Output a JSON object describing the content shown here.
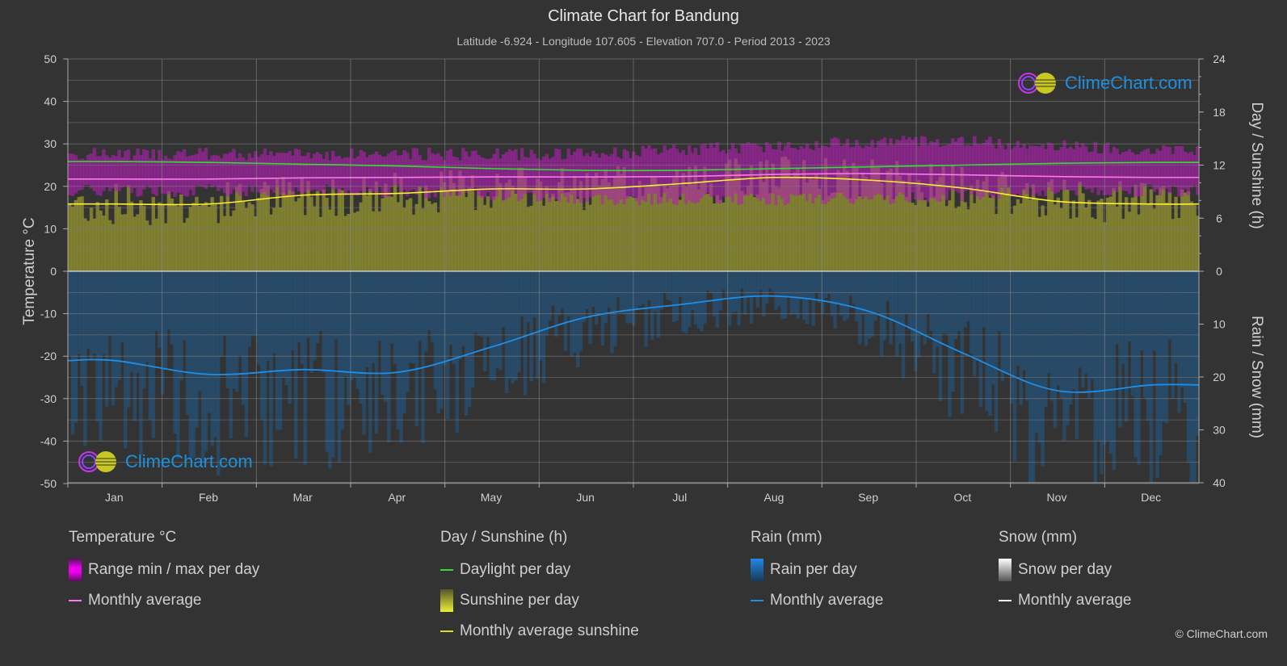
{
  "header": {
    "title": "Climate Chart for Bandung",
    "subtitle": "Latitude -6.924 - Longitude 107.605 - Elevation 707.0 - Period 2013 - 2023"
  },
  "logo": {
    "text": "ClimeChart.com"
  },
  "copyright": "© ClimeChart.com",
  "colors": {
    "background": "#333333",
    "temp_range": "#cc33cc",
    "temp_avg": "#ff77ee",
    "daylight": "#33dd33",
    "sunshine_fill": "#8a8a2e",
    "sunshine_avg": "#ffee33",
    "rain_fill": "#1f5a8a",
    "rain_avg": "#1e8fe8",
    "snow_avg": "#ffffff",
    "logo_text": "#1e90e0"
  },
  "legend": {
    "temperature": {
      "title": "Temperature °C",
      "range": "Range min / max per day",
      "avg": "Monthly average"
    },
    "sunshine": {
      "title": "Day / Sunshine (h)",
      "daylight": "Daylight per day",
      "sunshine": "Sunshine per day",
      "avg": "Monthly average sunshine"
    },
    "rain": {
      "title": "Rain (mm)",
      "per_day": "Rain per day",
      "avg": "Monthly average"
    },
    "snow": {
      "title": "Snow (mm)",
      "per_day": "Snow per day",
      "avg": "Monthly average"
    }
  },
  "chart_data": {
    "type": "line",
    "title": "Climate Chart for Bandung",
    "categories": [
      "Jan",
      "Feb",
      "Mar",
      "Apr",
      "May",
      "Jun",
      "Jul",
      "Aug",
      "Sep",
      "Oct",
      "Nov",
      "Dec"
    ],
    "axes": {
      "left": {
        "label": "Temperature °C",
        "range": [
          -50,
          50
        ],
        "ticks": [
          "50",
          "40",
          "30",
          "20",
          "10",
          "0",
          "-10",
          "-20",
          "-30",
          "-40",
          "-50"
        ]
      },
      "right_top": {
        "label": "Day / Sunshine (h)",
        "range": [
          0,
          24
        ],
        "ticks": [
          "24",
          "18",
          "12",
          "6",
          "0"
        ]
      },
      "right_bottom": {
        "label": "Rain / Snow (mm)",
        "range": [
          0,
          40
        ],
        "ticks": [
          "0",
          "10",
          "20",
          "30",
          "40"
        ]
      }
    },
    "grid": true,
    "series": [
      {
        "name": "Daylight per day",
        "unit": "h",
        "values": [
          12.4,
          12.3,
          12.1,
          11.9,
          11.6,
          11.4,
          11.4,
          11.6,
          11.8,
          12.0,
          12.2,
          12.3
        ]
      },
      {
        "name": "Temperature monthly average",
        "unit": "°C",
        "values": [
          21.7,
          21.7,
          22.0,
          22.1,
          22.2,
          22.2,
          22.3,
          22.8,
          23.0,
          22.7,
          22.3,
          22.1
        ]
      },
      {
        "name": "Temperature range max (approx)",
        "unit": "°C",
        "values": [
          27,
          27,
          27,
          27,
          27,
          27,
          28,
          29,
          30,
          30,
          29,
          28
        ]
      },
      {
        "name": "Temperature range min (approx)",
        "unit": "°C",
        "values": [
          19,
          19,
          19,
          19,
          18,
          17,
          17,
          17,
          17,
          18,
          19,
          19
        ]
      },
      {
        "name": "Monthly average sunshine",
        "unit": "h",
        "values": [
          7.6,
          7.6,
          8.6,
          8.8,
          9.3,
          9.3,
          9.9,
          10.6,
          10.3,
          9.4,
          7.9,
          7.6
        ]
      },
      {
        "name": "Rain monthly average",
        "unit": "mm",
        "values": [
          16.9,
          19.5,
          18.6,
          19.1,
          14.3,
          8.7,
          6.3,
          4.7,
          7.6,
          15.5,
          22.6,
          21.5
        ]
      },
      {
        "name": "Snow monthly average",
        "unit": "mm",
        "values": [
          0,
          0,
          0,
          0,
          0,
          0,
          0,
          0,
          0,
          0,
          0,
          0
        ]
      }
    ]
  }
}
